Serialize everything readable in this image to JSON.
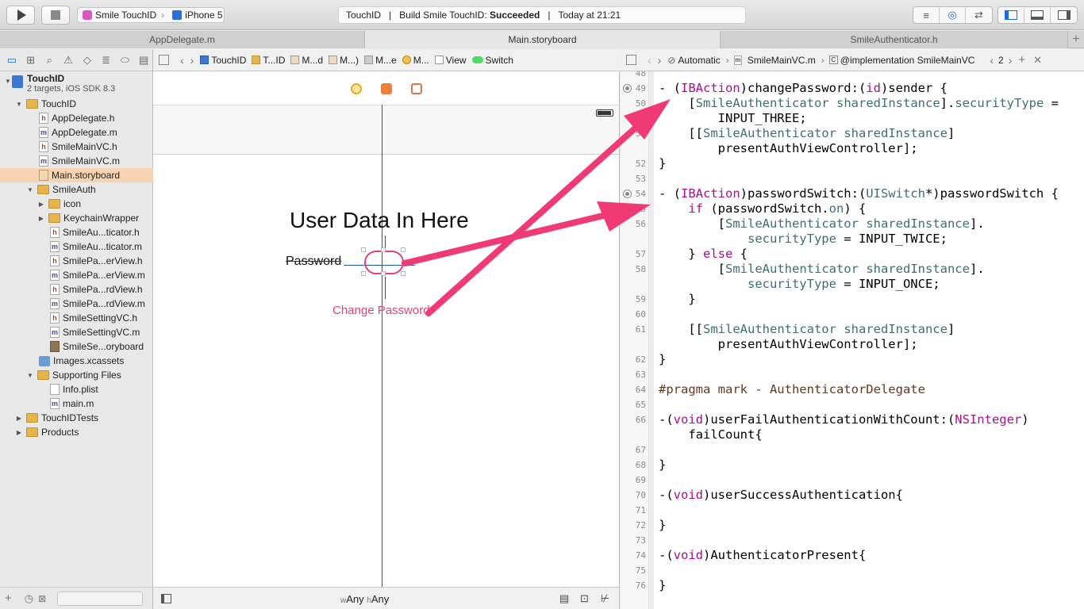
{
  "toolbar": {
    "scheme_target": "Smile TouchID",
    "scheme_device": "iPhone 5",
    "activity_project": "TouchID",
    "activity_prefix": "Build Smile TouchID: ",
    "activity_status": "Succeeded",
    "activity_time": "Today at 21:21"
  },
  "tabs": [
    {
      "label": "AppDelegate.m"
    },
    {
      "label": "Main.storyboard"
    },
    {
      "label": "SmileAuthenticator.h"
    }
  ],
  "navigator": {
    "project_name": "TouchID",
    "project_sub": "2 targets, iOS SDK 8.3",
    "items": [
      {
        "label": "TouchID"
      },
      {
        "label": "AppDelegate.h"
      },
      {
        "label": "AppDelegate.m"
      },
      {
        "label": "SmileMainVC.h"
      },
      {
        "label": "SmileMainVC.m"
      },
      {
        "label": "Main.storyboard"
      },
      {
        "label": "SmileAuth"
      },
      {
        "label": "icon"
      },
      {
        "label": "KeychainWrapper"
      },
      {
        "label": "SmileAu...ticator.h"
      },
      {
        "label": "SmileAu...ticator.m"
      },
      {
        "label": "SmilePa...erView.h"
      },
      {
        "label": "SmilePa...erView.m"
      },
      {
        "label": "SmilePa...rdView.h"
      },
      {
        "label": "SmilePa...rdView.m"
      },
      {
        "label": "SmileSettingVC.h"
      },
      {
        "label": "SmileSettingVC.m"
      },
      {
        "label": "SmileSe...oryboard"
      },
      {
        "label": "Images.xcassets"
      },
      {
        "label": "Supporting Files"
      },
      {
        "label": "Info.plist"
      },
      {
        "label": "main.m"
      },
      {
        "label": "TouchIDTests"
      },
      {
        "label": "Products"
      }
    ]
  },
  "ib_jumpbar": [
    "TouchID",
    "T...ID",
    "M...d",
    "M...)",
    "M...e",
    "M...",
    "View",
    "Switch"
  ],
  "editor_jumpbar": {
    "mode": "Automatic",
    "file": "SmileMainVC.m",
    "symbol": "@implementation SmileMainVC",
    "counter": "2"
  },
  "canvas": {
    "title": "User Data In Here",
    "password_label": "Password",
    "change_button": "Change Password",
    "size_w_prefix": "w",
    "size_w": "Any",
    "size_h_prefix": "h",
    "size_h": "Any"
  },
  "code": {
    "line_numbers": [
      "48",
      "49",
      "50",
      "51",
      "52",
      "53",
      "54",
      "55",
      "56",
      "57",
      "58",
      "59",
      "60",
      "61",
      "62",
      "63",
      "64",
      "65",
      "66",
      "67",
      "68",
      "69",
      "70",
      "71",
      "72",
      "73",
      "74",
      "75",
      "76"
    ]
  },
  "colors": {
    "annotation_arrow": "#f03a73",
    "keyword": "#aa0d91",
    "class_name": "#3f6e74",
    "preprocessor": "#643820",
    "selection": "#f5d3b3"
  }
}
